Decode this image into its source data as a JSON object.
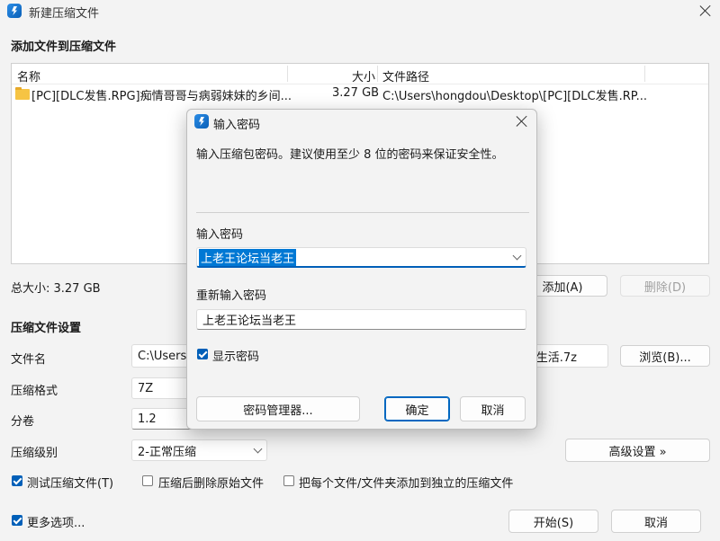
{
  "main_window": {
    "title": "新建压缩文件",
    "heading": "添加文件到压缩文件",
    "file_table": {
      "columns": {
        "name": "名称",
        "size": "大小",
        "path": "文件路径"
      },
      "rows": [
        {
          "name": "[PC][DLC发售.RPG]痴情哥哥与病弱妹妹的乡间...",
          "size": "3.27 GB",
          "path": "C:\\Users\\hongdou\\Desktop\\[PC][DLC发售.RP..."
        }
      ]
    },
    "total_size": "总大小: 3.27 GB",
    "add_button": "添加(A)",
    "delete_button": "删除(D)",
    "settings_heading": "压缩文件设置",
    "filename_label": "文件名",
    "filename_value_start": "C:\\Users\\",
    "filename_value_end": "生活.7z",
    "browse_button": "浏览(B)...",
    "format_label": "压缩格式",
    "format_value": "7Z",
    "volume_label": "分卷",
    "volume_value": "1.2",
    "level_label": "压缩级别",
    "level_value": "2-正常压缩",
    "advanced_button": "高级设置 »",
    "test_checkbox": "测试压缩文件(T)",
    "delete_after_checkbox": "压缩后删除原始文件",
    "separate_checkbox": "把每个文件/文件夹添加到独立的压缩文件",
    "more_options_checkbox": "更多选项...",
    "start_button": "开始(S)",
    "cancel_button": "取消"
  },
  "password_dialog": {
    "title": "输入密码",
    "description": "输入压缩包密码。建议使用至少 8 位的密码来保证安全性。",
    "password_label": "输入密码",
    "password_value": "上老王论坛当老王",
    "reenter_label": "重新输入密码",
    "reenter_value": "上老王论坛当老王",
    "show_password_checkbox": "显示密码",
    "manager_button": "密码管理器...",
    "ok_button": "确定",
    "cancel_button": "取消"
  },
  "colors": {
    "accent": "#005fb8",
    "selection": "#0078d4",
    "window_bg": "#f3f3f3"
  }
}
